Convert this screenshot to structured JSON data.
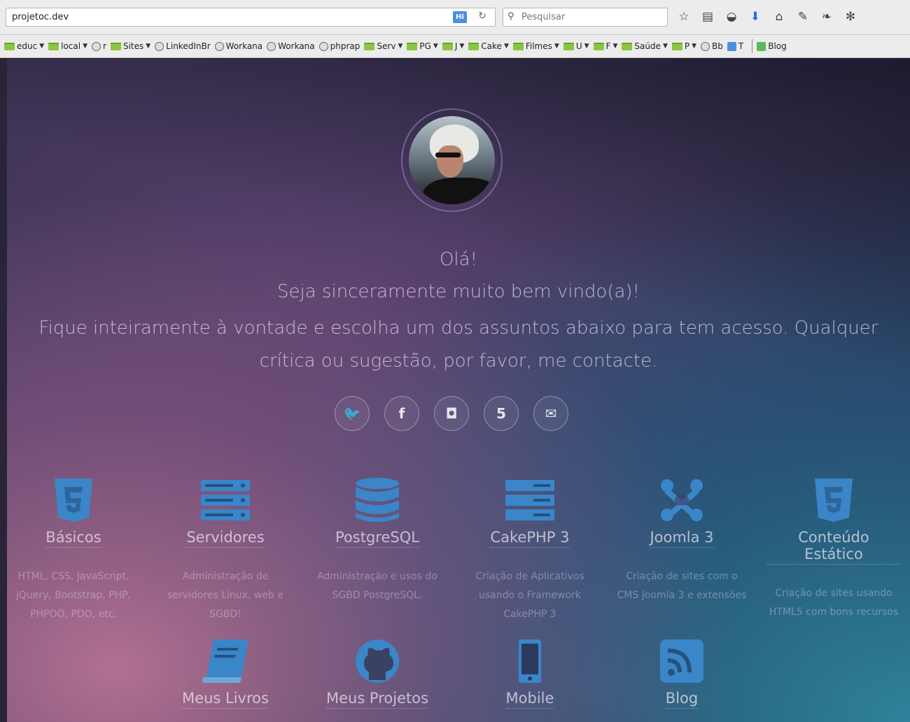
{
  "browser": {
    "url": "projetoc.dev",
    "hi_badge": "Hi",
    "search_placeholder": "Pesquisar",
    "toolbar_icons": [
      "star-icon",
      "reading-list-icon",
      "pocket-icon",
      "download-icon",
      "home-icon",
      "extension-icon",
      "addon-icon",
      "addon-icon-2"
    ]
  },
  "bookmarks": [
    {
      "label": "educ",
      "type": "folder",
      "menu": true
    },
    {
      "label": "local",
      "type": "folder",
      "menu": true
    },
    {
      "label": "r",
      "type": "site",
      "menu": false
    },
    {
      "label": "Sites",
      "type": "folder",
      "menu": true
    },
    {
      "label": "LinkedInBr",
      "type": "site",
      "menu": false
    },
    {
      "label": "Workana",
      "type": "site",
      "menu": false
    },
    {
      "label": "Workana",
      "type": "site",
      "menu": false
    },
    {
      "label": "phprap",
      "type": "site",
      "menu": false
    },
    {
      "label": "Serv",
      "type": "folder",
      "menu": true
    },
    {
      "label": "PG",
      "type": "folder",
      "menu": true
    },
    {
      "label": "J",
      "type": "folder",
      "menu": true
    },
    {
      "label": "Cake",
      "type": "folder",
      "menu": true
    },
    {
      "label": "Filmes",
      "type": "folder",
      "menu": true
    },
    {
      "label": "U",
      "type": "folder",
      "menu": true
    },
    {
      "label": "F",
      "type": "folder",
      "menu": true
    },
    {
      "label": "Saúde",
      "type": "folder",
      "menu": true
    },
    {
      "label": "P",
      "type": "folder",
      "menu": true
    },
    {
      "label": "Bb",
      "type": "site",
      "menu": false
    },
    {
      "label": "T",
      "type": "t",
      "menu": false
    },
    {
      "label": "Blog",
      "type": "blog",
      "menu": false
    }
  ],
  "hero": {
    "greeting": "Olá!",
    "welcome": "Seja sinceramente muito bem vindo(a)!",
    "intro": "Fique inteiramente à vontade e escolha um dos assuntos abaixo para tem acesso. Qualquer crítica ou sugestão, por favor, me contacte."
  },
  "social": [
    {
      "name": "twitter-icon",
      "glyph": "🐦"
    },
    {
      "name": "facebook-icon",
      "glyph": "f"
    },
    {
      "name": "instagram-icon",
      "glyph": "◘"
    },
    {
      "name": "html5-icon",
      "glyph": "5"
    },
    {
      "name": "email-icon",
      "glyph": "✉"
    }
  ],
  "cards": [
    {
      "icon": "html5-icon",
      "title": "Básicos",
      "desc": "HTML, CSS, JavaScript, jQuery, Bootstrap, PHP, PHPOO, PDO, etc."
    },
    {
      "icon": "server-icon",
      "title": "Servidores",
      "desc": "Administração de servidores Linux, web e SGBD!"
    },
    {
      "icon": "database-icon",
      "title": "PostgreSQL",
      "desc": "Administração e usos do SGBD PostgreSQL."
    },
    {
      "icon": "server-stack-icon",
      "title": "CakePHP 3",
      "desc": "Criação de Aplicativos usando o Framework CakePHP 3"
    },
    {
      "icon": "joomla-icon",
      "title": "Joomla 3",
      "desc": "Criação de sites com o CMS Joomla 3 e extensões"
    },
    {
      "icon": "html5-icon",
      "title": "Conteúdo Estático",
      "desc": "Criação de sites usando HTML5 com bons recursos"
    },
    {
      "icon": "book-icon",
      "title": "Meus Livros",
      "desc": ""
    },
    {
      "icon": "github-icon",
      "title": "Meus Projetos",
      "desc": ""
    },
    {
      "icon": "mobile-icon",
      "title": "Mobile",
      "desc": ""
    },
    {
      "icon": "rss-icon",
      "title": "Blog",
      "desc": ""
    }
  ],
  "colors": {
    "icon_blue": "#3a86c8",
    "bookmark_folder": "#8cc63f"
  }
}
